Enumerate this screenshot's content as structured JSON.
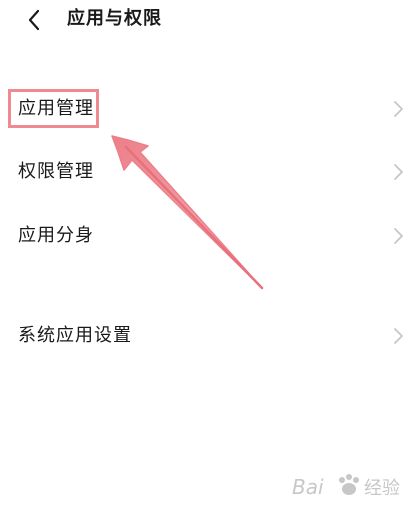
{
  "header": {
    "title": "应用与权限"
  },
  "menu": {
    "items": [
      {
        "label": "应用管理"
      },
      {
        "label": "权限管理"
      },
      {
        "label": "应用分身"
      },
      {
        "label": "系统应用设置"
      }
    ]
  },
  "watermark": {
    "text": "Bai",
    "suffix": "经验"
  },
  "colors": {
    "annotation": "#ef8a93",
    "chevron": "#c6c6c6",
    "text": "#1a1a1a"
  }
}
